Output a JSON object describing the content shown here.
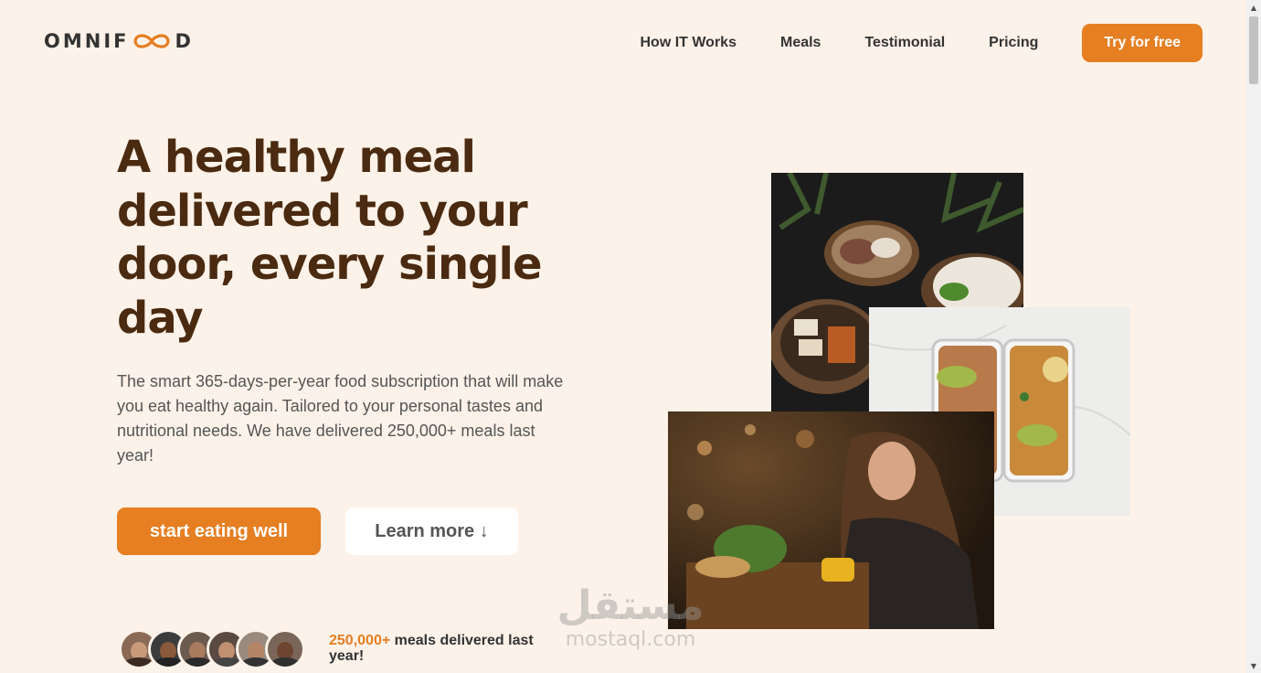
{
  "header": {
    "logo_prefix": "OMNIF",
    "logo_suffix": "D",
    "nav": [
      {
        "label": "How IT Works"
      },
      {
        "label": "Meals"
      },
      {
        "label": "Testimonial"
      },
      {
        "label": "Pricing"
      }
    ],
    "cta_label": "Try for free"
  },
  "hero": {
    "title": "A healthy meal delivered to your door, every single day",
    "description": "The smart 365-days-per-year food subscription that will make you eat healthy again. Tailored to your personal tastes and nutritional needs. We have delivered 250,000+ meals last year!",
    "primary_button": "start eating well",
    "secondary_button": "Learn more ↓"
  },
  "delivered": {
    "count": "250,000+",
    "text": " meals delivered last year!"
  },
  "watermark": {
    "arabic": "مستقل",
    "latin": "mostaql.com"
  },
  "colors": {
    "accent": "#e67e22",
    "background": "#fdf2e9",
    "title": "#4a2a10"
  },
  "icons": {
    "logo_mark": "infinity-icon",
    "scroll_up": "chevron-up-icon",
    "scroll_down": "chevron-down-icon"
  }
}
